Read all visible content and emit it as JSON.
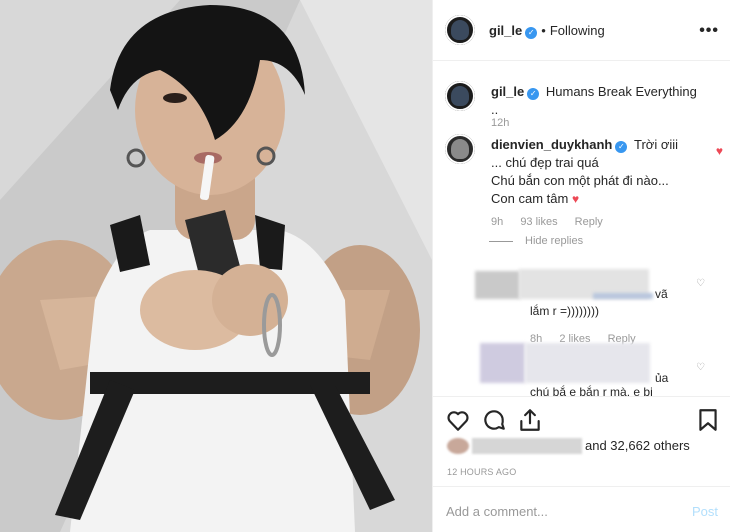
{
  "post": {
    "author": "gil_le",
    "follow_status": "Following",
    "more_icon": "•••",
    "verified_icon": "✓"
  },
  "caption": {
    "user": "gil_le",
    "text": "Humans Break Everything ..",
    "time": "12h"
  },
  "comment": {
    "user": "dienvien_duykhanh",
    "text_l1": "Trời ơiii",
    "text_l2": "... chú đẹp trai quá",
    "text_l3": "Chú bắn con một phát đi nào...",
    "text_l4": "Con cam tâm",
    "text_heart": "♥",
    "time": "9h",
    "likes": "93 likes",
    "reply": "Reply",
    "hide_replies": "Hide replies"
  },
  "replies": [
    {
      "text_a": "vã",
      "text_b": "lắm r =))))))))",
      "time": "8h",
      "likes": "2 likes",
      "reply": "Reply"
    },
    {
      "text_a": "ủa",
      "text_b": "chú bắ e bắn r mà, e bị"
    }
  ],
  "actions": {
    "likes_suffix": "and 32,662 others",
    "timestamp": "12 HOURS AGO"
  },
  "add_comment": {
    "placeholder": "Add a comment...",
    "post_label": "Post"
  },
  "colors": {
    "verified": "#3897f0",
    "liked_heart": "#ed4956",
    "post_disabled": "#b2dffc"
  }
}
